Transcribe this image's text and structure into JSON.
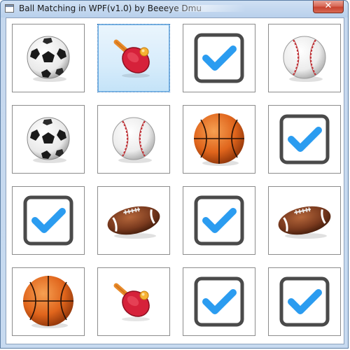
{
  "window": {
    "title": "Ball Matching in WPF(v1.0) by Beeeye Dmu",
    "close_glyph": "✕"
  },
  "board": {
    "cards": [
      {
        "icon": "soccer-ball-icon",
        "state": "hidden"
      },
      {
        "icon": "ping-pong-paddle-icon",
        "state": "selected"
      },
      {
        "icon": "check-mark-icon",
        "state": "matched"
      },
      {
        "icon": "baseball-icon",
        "state": "hidden"
      },
      {
        "icon": "soccer-ball-icon",
        "state": "hidden"
      },
      {
        "icon": "baseball-icon",
        "state": "hidden"
      },
      {
        "icon": "basketball-icon",
        "state": "hidden"
      },
      {
        "icon": "check-mark-icon",
        "state": "matched"
      },
      {
        "icon": "check-mark-icon",
        "state": "matched"
      },
      {
        "icon": "football-icon",
        "state": "hidden"
      },
      {
        "icon": "check-mark-icon",
        "state": "matched"
      },
      {
        "icon": "football-icon",
        "state": "hidden"
      },
      {
        "icon": "basketball-icon",
        "state": "hidden"
      },
      {
        "icon": "ping-pong-paddle-icon",
        "state": "hidden"
      },
      {
        "icon": "check-mark-icon",
        "state": "matched"
      },
      {
        "icon": "check-mark-icon",
        "state": "matched"
      }
    ]
  },
  "colors": {
    "check_blue": "#2b9cf0",
    "check_box": "#4a4a4a",
    "basketball": "#e0651c",
    "paddle_red": "#d6213a",
    "paddle_handle": "#e88a2a",
    "football_brown": "#7a3a1e"
  }
}
